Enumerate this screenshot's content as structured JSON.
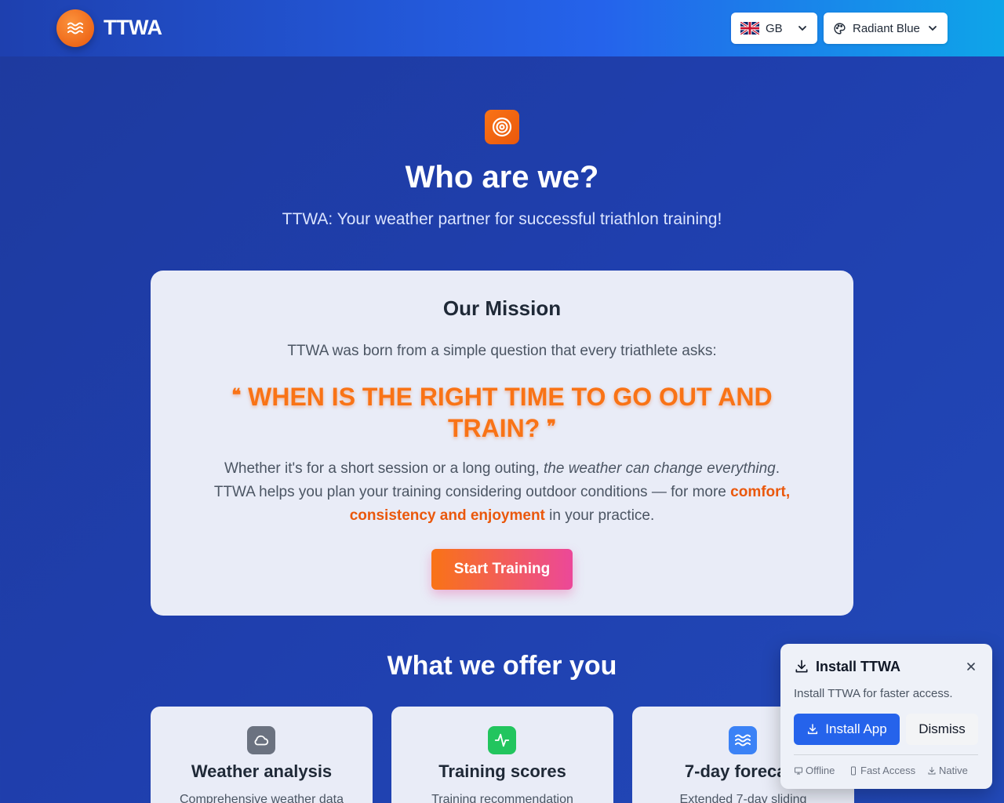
{
  "header": {
    "brand": "TTWA",
    "language": {
      "flag": "uk-flag",
      "label": "GB"
    },
    "theme": {
      "label": "Radiant Blue"
    }
  },
  "hero": {
    "icon": "target-icon",
    "title": "Who are we?",
    "subtitle": "TTWA: Your weather partner for successful triathlon training!"
  },
  "mission": {
    "title": "Our Mission",
    "intro": "TTWA was born from a simple question that every triathlete asks:",
    "quote_open": "❝",
    "quote": "WHEN IS THE RIGHT TIME TO GO OUT AND TRAIN?",
    "quote_close": "❞",
    "body_1": "Whether it's for a short session or a long outing, ",
    "body_em": "the weather can change everything",
    "body_2": ". TTWA helps you plan your training considering outdoor conditions — for more ",
    "body_highlight": "comfort, consistency and enjoyment",
    "body_3": " in your practice.",
    "cta": "Start Training"
  },
  "offer": {
    "title": "What we offer you",
    "features": [
      {
        "icon": "cloud-icon",
        "title": "Weather analysis",
        "desc": "Comprehensive weather data"
      },
      {
        "icon": "activity-icon",
        "title": "Training scores",
        "desc": "Training recommendation"
      },
      {
        "icon": "waves-icon",
        "title": "7-day forecast",
        "desc": "Extended 7-day sliding"
      }
    ]
  },
  "install": {
    "title": "Install TTWA",
    "desc": "Install TTWA for faster access.",
    "install_label": "Install App",
    "dismiss_label": "Dismiss",
    "features": [
      "Offline",
      "Fast Access",
      "Native"
    ]
  },
  "colors": {
    "accent_orange": "#f97316",
    "primary_blue": "#2563eb",
    "background": "#1f3fae"
  }
}
